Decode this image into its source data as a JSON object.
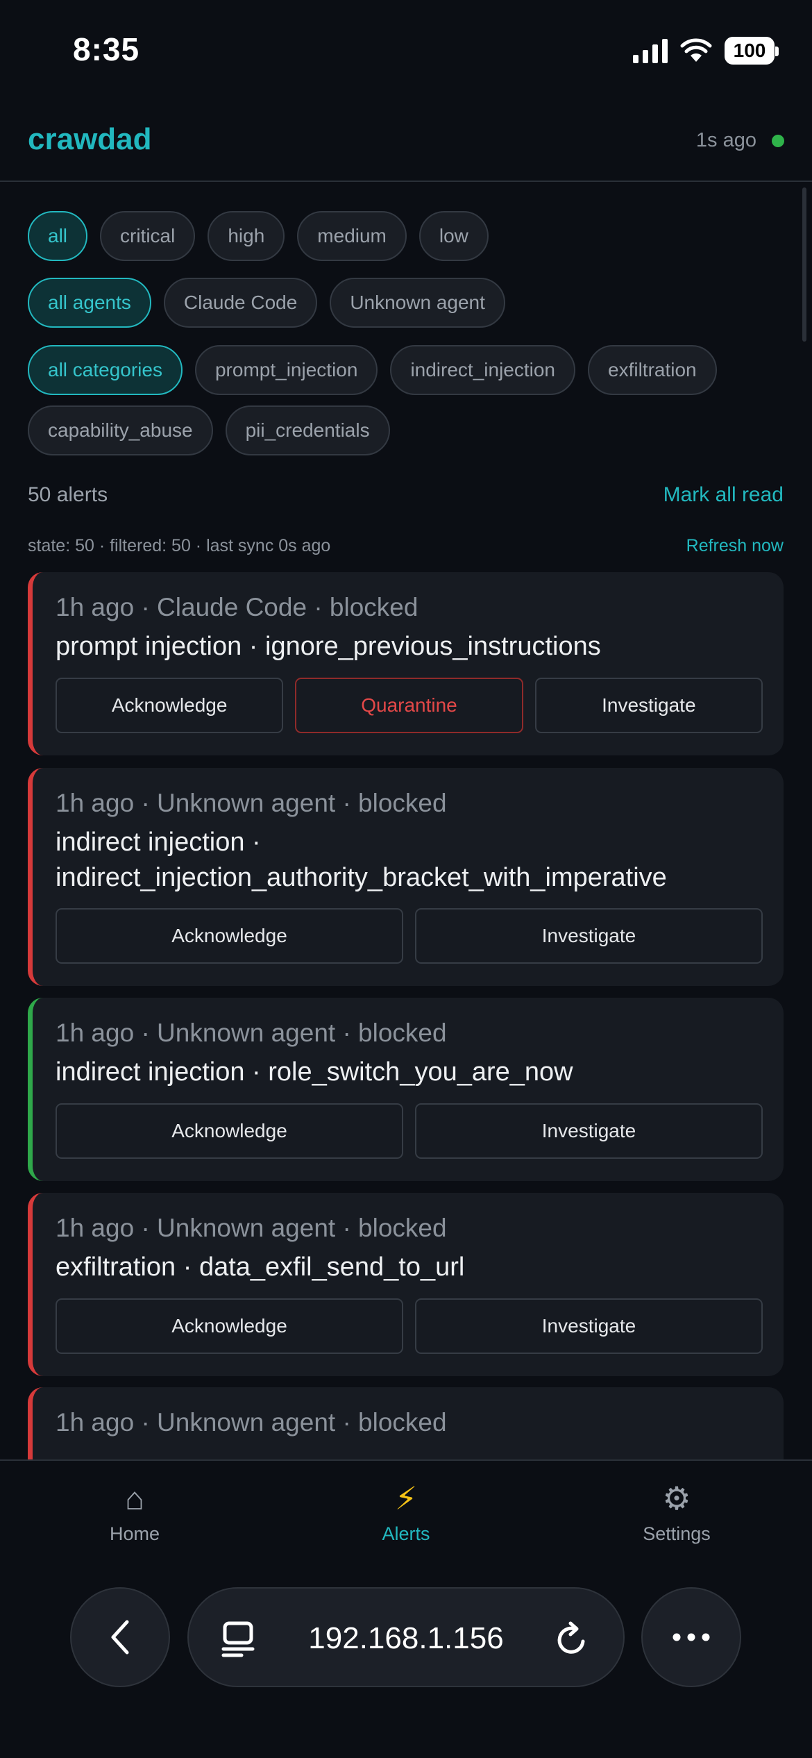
{
  "status_bar": {
    "time": "8:35",
    "battery": "100"
  },
  "header": {
    "title": "crawdad",
    "sync_ago": "1s ago"
  },
  "filters": {
    "severity": [
      "all",
      "critical",
      "high",
      "medium",
      "low"
    ],
    "agents": [
      "all agents",
      "Claude Code",
      "Unknown agent"
    ],
    "categories": [
      "all categories",
      "prompt_injection",
      "indirect_injection",
      "exfiltration",
      "capability_abuse",
      "pii_credentials"
    ]
  },
  "summary": {
    "count": "50 alerts",
    "mark_all_read": "Mark all read",
    "state_line": "state: 50 · filtered: 50 · last sync 0s ago",
    "refresh": "Refresh now"
  },
  "alerts": [
    {
      "meta": "1h ago · Claude Code · blocked",
      "title": "prompt injection · ignore_previous_instructions",
      "severity_color": "#d63a3a",
      "acknowledge": "Acknowledge",
      "quarantine": "Quarantine",
      "investigate": "Investigate"
    },
    {
      "meta": "1h ago · Unknown agent · blocked",
      "title_line1": "indirect injection ·",
      "title_line2": "indirect_injection_authority_bracket_with_imperative",
      "severity_color": "#d63a3a",
      "acknowledge": "Acknowledge",
      "investigate": "Investigate"
    },
    {
      "meta": "1h ago · Unknown agent · blocked",
      "title": "indirect injection · role_switch_you_are_now",
      "severity_color": "#2fa84a",
      "acknowledge": "Acknowledge",
      "investigate": "Investigate"
    },
    {
      "meta": "1h ago · Unknown agent · blocked",
      "title": "exfiltration · data_exfil_send_to_url",
      "severity_color": "#d63a3a",
      "acknowledge": "Acknowledge",
      "investigate": "Investigate"
    },
    {
      "meta": "1h ago · Unknown agent · blocked",
      "severity_color": "#d63a3a"
    }
  ],
  "nav": {
    "home": "Home",
    "home_icon": "⌂",
    "alerts": "Alerts",
    "alerts_icon": "⚡",
    "settings": "Settings",
    "settings_icon": "⚙"
  },
  "browser": {
    "url": "192.168.1.156"
  },
  "colors": {
    "accent": "#22b8bf",
    "critical": "#d63a3a",
    "low": "#2fa84a",
    "live": "#2fb34a",
    "background": "#0b0e14",
    "card": "#171b22"
  }
}
